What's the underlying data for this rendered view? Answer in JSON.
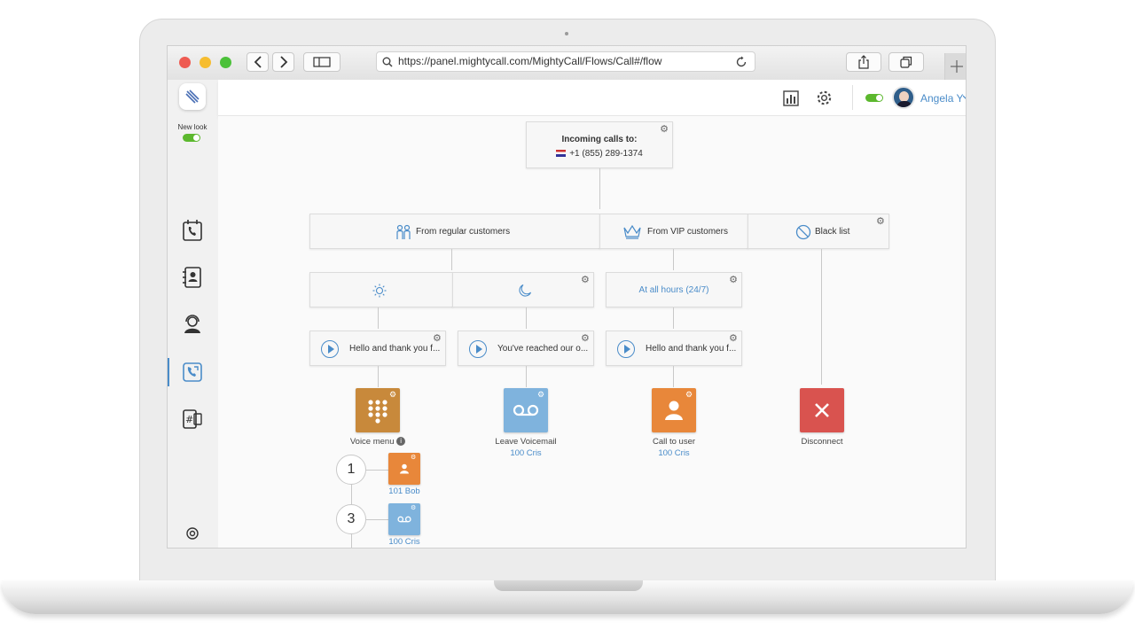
{
  "browser": {
    "url": "https://panel.mightycall.com/MightyCall/Flows/Call#/flow"
  },
  "header": {
    "user_name": "Angela Y"
  },
  "sidebar": {
    "new_look_label": "New look"
  },
  "flow": {
    "incoming": {
      "title": "Incoming calls to:",
      "number": "+1 (855) 289-1374"
    },
    "groups": [
      {
        "label": "From regular customers"
      },
      {
        "label": "From VIP customers"
      },
      {
        "label": "Black list"
      }
    ],
    "schedule": {
      "vip_label": "At all hours (24/7)"
    },
    "greetings": [
      {
        "text": "Hello and thank you f..."
      },
      {
        "text": "You've reached our o..."
      },
      {
        "text": "Hello and thank you f..."
      }
    ],
    "actions": [
      {
        "label": "Voice menu",
        "sub": ""
      },
      {
        "label": "Leave Voicemail",
        "sub": "100 Cris"
      },
      {
        "label": "Call to user",
        "sub": "100 Cris"
      },
      {
        "label": "Disconnect",
        "sub": ""
      }
    ],
    "menu_options": [
      {
        "key": "1",
        "target": "101 Bob"
      },
      {
        "key": "3",
        "target": "100 Cris"
      }
    ]
  },
  "colors": {
    "voice_menu": "#c8893b",
    "voicemail": "#7fb3dd",
    "call_user": "#e8873a",
    "disconnect": "#d9534f",
    "toggle": "#5cb82e",
    "accent_blue": "#4a8cc9"
  }
}
